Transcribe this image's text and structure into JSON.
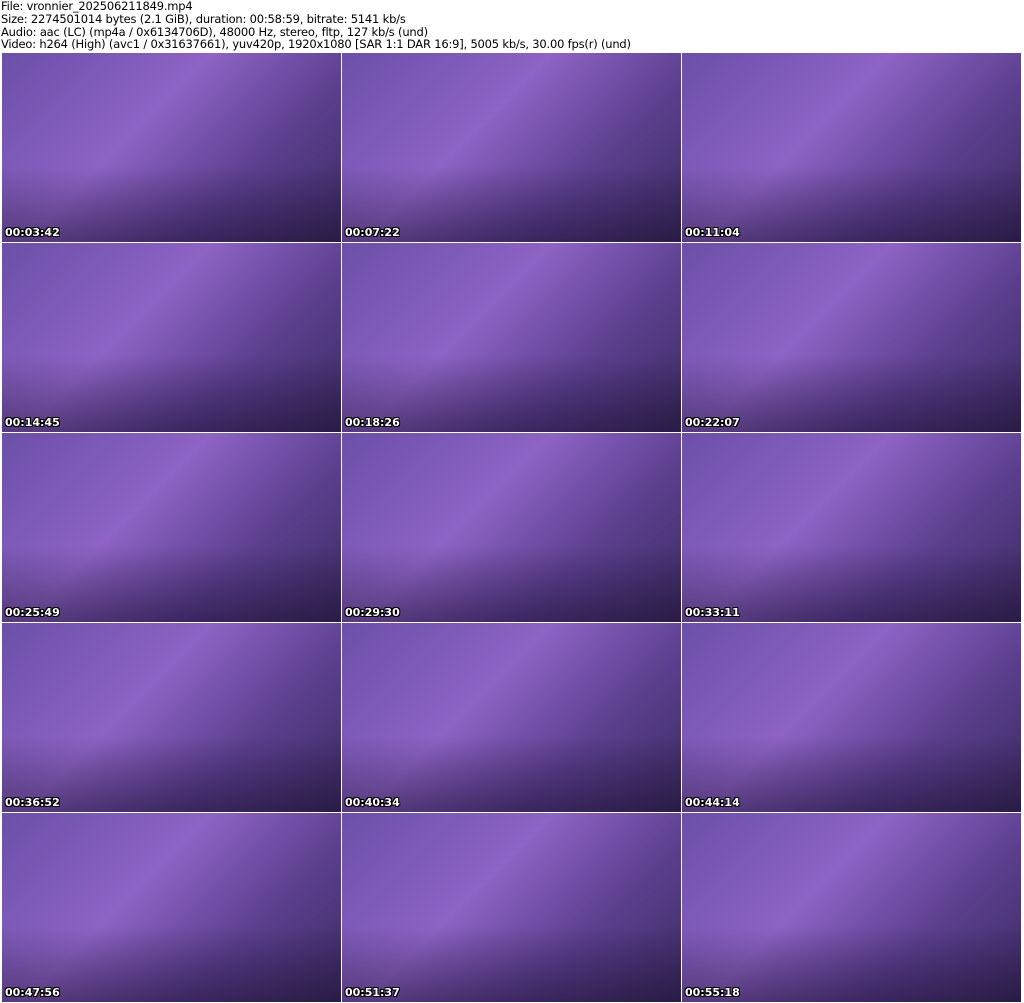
{
  "header": {
    "file": "File: vronnier_202506211849.mp4",
    "size": "Size: 2274501014 bytes (2.1 GiB), duration: 00:58:59, bitrate: 5141 kb/s",
    "audio": "Audio: aac (LC) (mp4a / 0x6134706D), 48000 Hz, stereo, fltp, 127 kb/s (und)",
    "video": "Video: h264 (High) (avc1 / 0x31637661), yuv420p, 1920x1080 [SAR 1:1 DAR 16:9], 5005 kb/s, 30.00 fps(r) (und)"
  },
  "thumbnails": [
    "00:03:42",
    "00:07:22",
    "00:11:04",
    "00:14:45",
    "00:18:26",
    "00:22:07",
    "00:25:49",
    "00:29:30",
    "00:33:11",
    "00:36:52",
    "00:40:34",
    "00:44:14",
    "00:47:56",
    "00:51:37",
    "00:55:18"
  ]
}
